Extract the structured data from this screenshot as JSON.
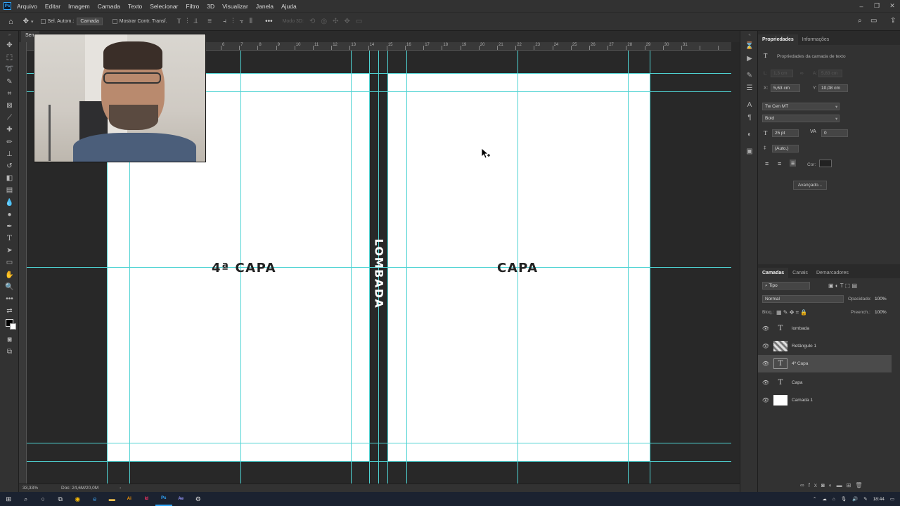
{
  "menubar": {
    "logo": "Ps",
    "items": [
      "Arquivo",
      "Editar",
      "Imagem",
      "Camada",
      "Texto",
      "Selecionar",
      "Filtro",
      "3D",
      "Visualizar",
      "Janela",
      "Ajuda"
    ]
  },
  "options": {
    "auto_select": "Sel. Autom.:",
    "auto_select_target": "Camada",
    "show_transform": "Mostrar Contr. Transf.",
    "mode_3d": "Modo 3D:"
  },
  "document": {
    "tab_title": "Sem",
    "ruler_numbers": [
      "6",
      "7",
      "8",
      "9",
      "10",
      "11",
      "12",
      "13",
      "14",
      "15",
      "16",
      "17",
      "18",
      "19",
      "20",
      "21",
      "22",
      "23",
      "24",
      "25",
      "26",
      "27",
      "28",
      "29",
      "30",
      "31"
    ],
    "back_cover_label": "4ª CAPA",
    "spine_label": "LOMBADA",
    "front_cover_label": "CAPA"
  },
  "status": {
    "zoom": "33,33%",
    "doc_size": "Doc: 24,6M/20,0M"
  },
  "properties": {
    "tabs": [
      "Propriedades",
      "Informações"
    ],
    "header": "Propriedades da camada de texto",
    "w_label": "L:",
    "w_value": "1,3 cm",
    "h_label": "A:",
    "h_value": "5,83 cm",
    "x_label": "X:",
    "x_value": "5,63 cm",
    "y_label": "Y:",
    "y_value": "10,08 cm",
    "font_family": "Tw Cen MT",
    "font_style": "Bold",
    "font_size": "25 pt",
    "tracking": "0",
    "leading": "(Auto.)",
    "color_label": "Cor:",
    "advanced_button": "Avançado..."
  },
  "layers_panel": {
    "tabs": [
      "Camadas",
      "Canais",
      "Demarcadores"
    ],
    "filter": "Tipo",
    "blend_mode": "Normal",
    "opacity_label": "Opacidade:",
    "opacity_value": "100%",
    "lock_label": "Bloq.:",
    "fill_label": "Preench.:",
    "fill_value": "100%",
    "layers": [
      {
        "name": "lombada",
        "kind": "text"
      },
      {
        "name": "Retângulo 1",
        "kind": "shape"
      },
      {
        "name": "4ª Capa",
        "kind": "text",
        "selected": true
      },
      {
        "name": "Capa",
        "kind": "text"
      },
      {
        "name": "Camada 1",
        "kind": "fill"
      }
    ]
  },
  "taskbar": {
    "time": "18:44"
  },
  "colors": {
    "guide": "#4fd3d3",
    "ui_dark": "#323232",
    "canvas_bg": "#282828",
    "accent_ps": "#31a8ff"
  }
}
